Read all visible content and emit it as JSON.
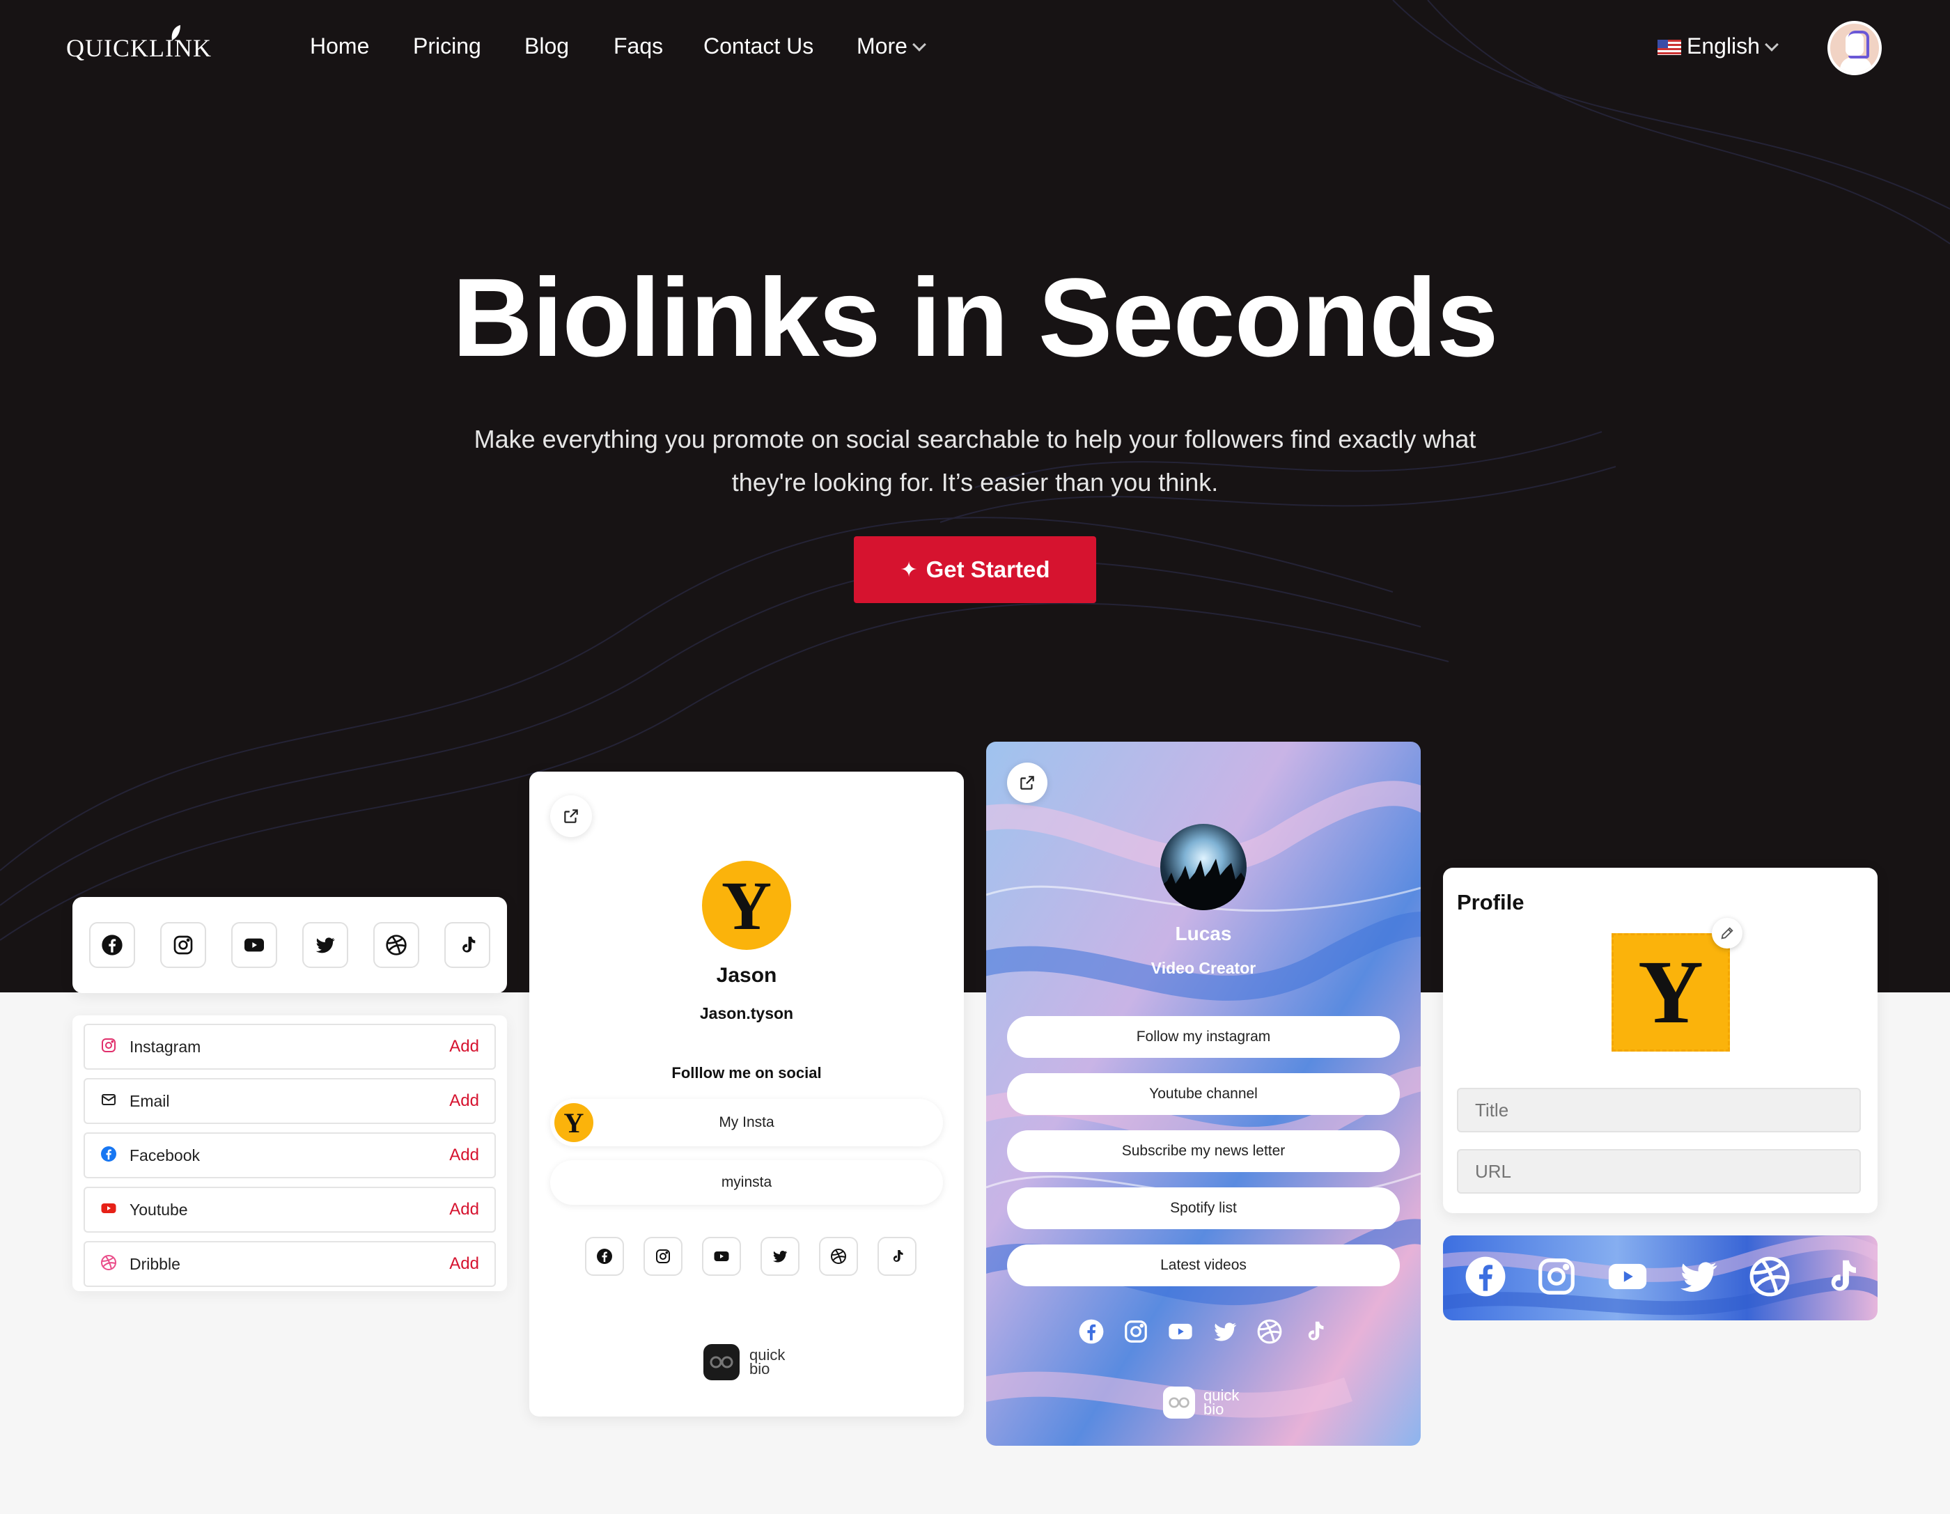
{
  "brand": {
    "logo_text": "QUICKLINK"
  },
  "nav": {
    "items": [
      "Home",
      "Pricing",
      "Blog",
      "Faqs",
      "Contact Us"
    ],
    "more_label": "More",
    "language": "English"
  },
  "hero": {
    "title": "Biolinks in Seconds",
    "subtitle_line1": "Make everything you promote on social searchable to help your followers find exactly what",
    "subtitle_line2": "they're looking for. It’s easier than you think.",
    "cta": "Get Started"
  },
  "social_icons": [
    "facebook-icon",
    "instagram-icon",
    "youtube-icon",
    "twitter-icon",
    "dribbble-icon",
    "tiktok-icon"
  ],
  "link_list": {
    "add_label": "Add",
    "items": [
      {
        "label": "Instagram",
        "icon": "instagram-icon",
        "color": "#e1306c"
      },
      {
        "label": "Email",
        "icon": "email-icon",
        "color": "#222222"
      },
      {
        "label": "Facebook",
        "icon": "facebook-icon",
        "color": "#1877f2"
      },
      {
        "label": "Youtube",
        "icon": "youtube-icon",
        "color": "#e62117"
      },
      {
        "label": "Dribble",
        "icon": "dribbble-icon",
        "color": "#ea4c89"
      }
    ]
  },
  "profile_jason": {
    "avatar_letter": "Y",
    "name": "Jason",
    "handle": "Jason.tyson",
    "follow_text": "Folllow me on social",
    "links": [
      "My Insta",
      "myinsta"
    ],
    "footer_brand_line1": "quick",
    "footer_brand_line2": "bio"
  },
  "profile_lucas": {
    "name": "Lucas",
    "role": "Video Creator",
    "links": [
      "Follow my instagram",
      "Youtube channel",
      "Subscribe my news letter",
      "Spotify list",
      "Latest videos"
    ],
    "footer_brand_line1": "quick",
    "footer_brand_line2": "bio"
  },
  "profile_editor": {
    "heading": "Profile",
    "avatar_letter": "Y",
    "title_placeholder": "Title",
    "url_placeholder": "URL"
  },
  "colors": {
    "hero_bg": "#171314",
    "accent": "#d6132f",
    "yellow": "#fbb30b"
  }
}
